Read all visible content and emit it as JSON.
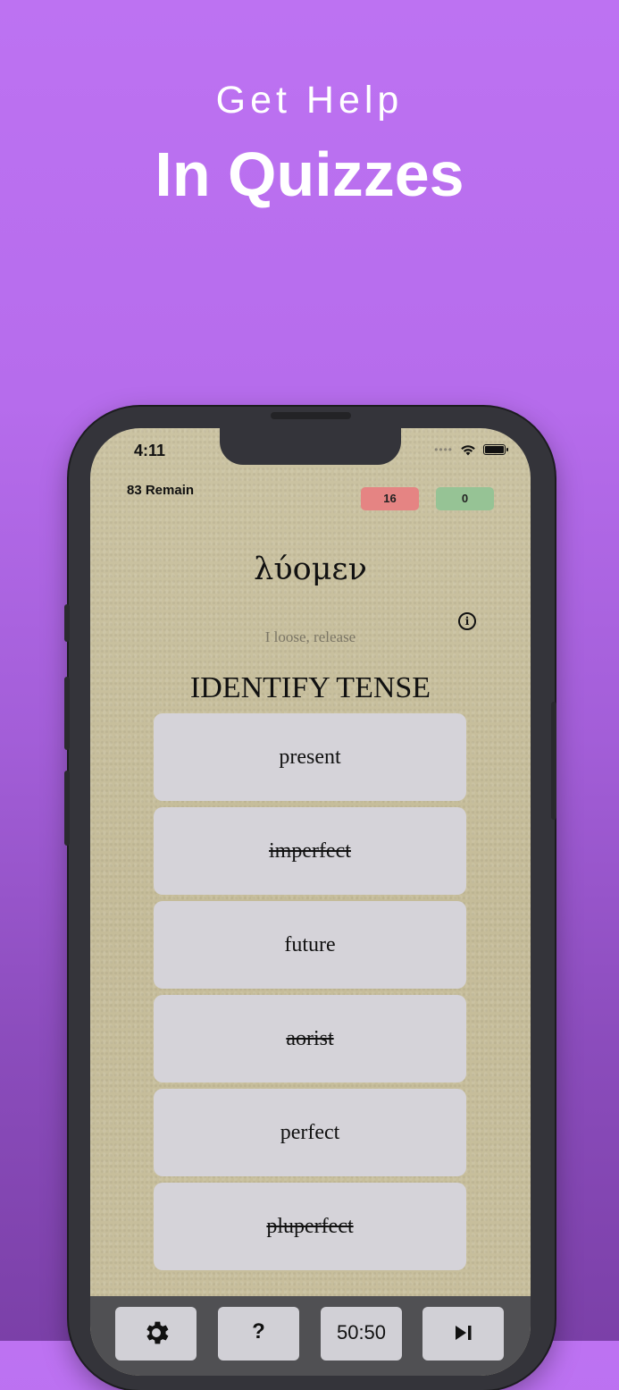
{
  "headline": {
    "top": "Get Help",
    "main": "In Quizzes"
  },
  "status_bar": {
    "time": "4:11"
  },
  "quiz": {
    "remain_label": "83 Remain",
    "wrong_count": "16",
    "right_count": "0",
    "word": "λύομεν",
    "gloss": "I loose, release",
    "prompt": "IDENTIFY TENSE",
    "answers": [
      {
        "label": "present",
        "eliminated": false
      },
      {
        "label": "imperfect",
        "eliminated": true
      },
      {
        "label": "future",
        "eliminated": false
      },
      {
        "label": "aorist",
        "eliminated": true
      },
      {
        "label": "perfect",
        "eliminated": false
      },
      {
        "label": "pluperfect",
        "eliminated": true
      }
    ]
  },
  "toolbar": {
    "help_label": "?",
    "fifty_label": "50:50",
    "icons": [
      "gear-icon",
      "skip-icon"
    ]
  },
  "colors": {
    "background_top": "#bd72f2",
    "background_bottom": "#7b40a8",
    "wrong_badge": "#e58483",
    "right_badge": "#96c395",
    "answer_bg": "#d5d3d9",
    "paper": "#c9c09e"
  }
}
